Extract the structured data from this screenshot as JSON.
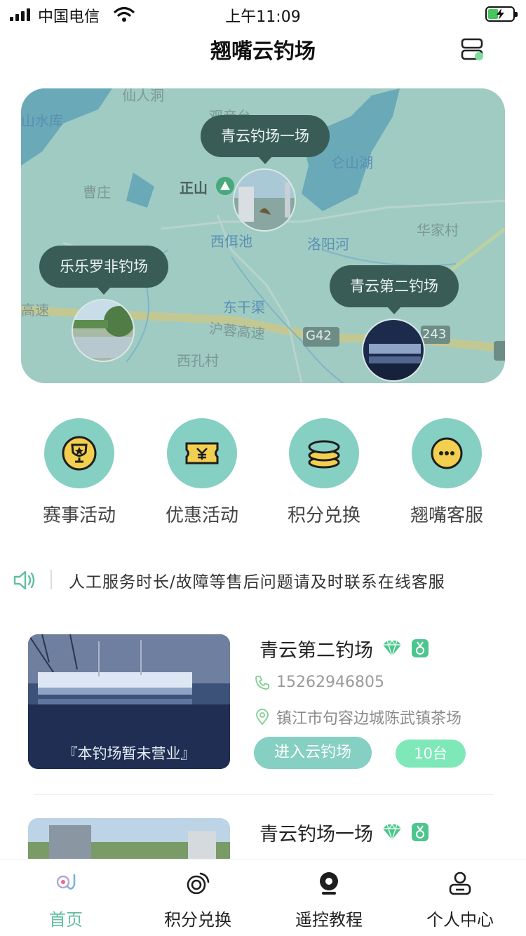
{
  "status_bar": {
    "carrier": "中国电信",
    "time": "上午11:09"
  },
  "header": {
    "title": "翘嘴云钓场",
    "scan_icon": "scan-toggle-icon"
  },
  "map": {
    "place_labels": [
      "仙人洞",
      "山水库",
      "观音台",
      "曹庄",
      "正山",
      "仑山湖",
      "西佴池",
      "洛阳河",
      "华家村",
      "高速",
      "东干渠",
      "沪蓉高速",
      "西孔村",
      "G42",
      "243"
    ],
    "markers": [
      {
        "label": "青云钓场一场"
      },
      {
        "label": "乐乐罗非钓场"
      },
      {
        "label": "青云第二钓场"
      }
    ]
  },
  "quick_menu": [
    {
      "label": "赛事活动",
      "icon": "trophy-icon"
    },
    {
      "label": "优惠活动",
      "icon": "ticket-icon"
    },
    {
      "label": "积分兑换",
      "icon": "coins-icon"
    },
    {
      "label": "翘嘴客服",
      "icon": "chat-icon"
    }
  ],
  "notice": {
    "text": "人工服务时长/故障等售后问题请及时联系在线客服"
  },
  "listings": [
    {
      "name": "青云第二钓场",
      "phone": "15262946805",
      "address": "镇江市句容边城陈武镇茶场",
      "status_overlay": "『本钓场暂未营业』",
      "enter_label": "进入云钓场",
      "device_count": "10台"
    },
    {
      "name": "青云钓场一场"
    }
  ],
  "tab_bar": [
    {
      "label": "首页",
      "icon": "home-fishhook-icon",
      "active": true
    },
    {
      "label": "积分兑换",
      "icon": "points-icon",
      "active": false
    },
    {
      "label": "遥控教程",
      "icon": "camera-icon",
      "active": false
    },
    {
      "label": "个人中心",
      "icon": "user-icon",
      "active": false
    }
  ],
  "colors": {
    "accent": "#86cfc3",
    "active_tab": "#5fbf9c",
    "badge": "#7ee8b8",
    "map_bubble": "#3a5c57"
  }
}
